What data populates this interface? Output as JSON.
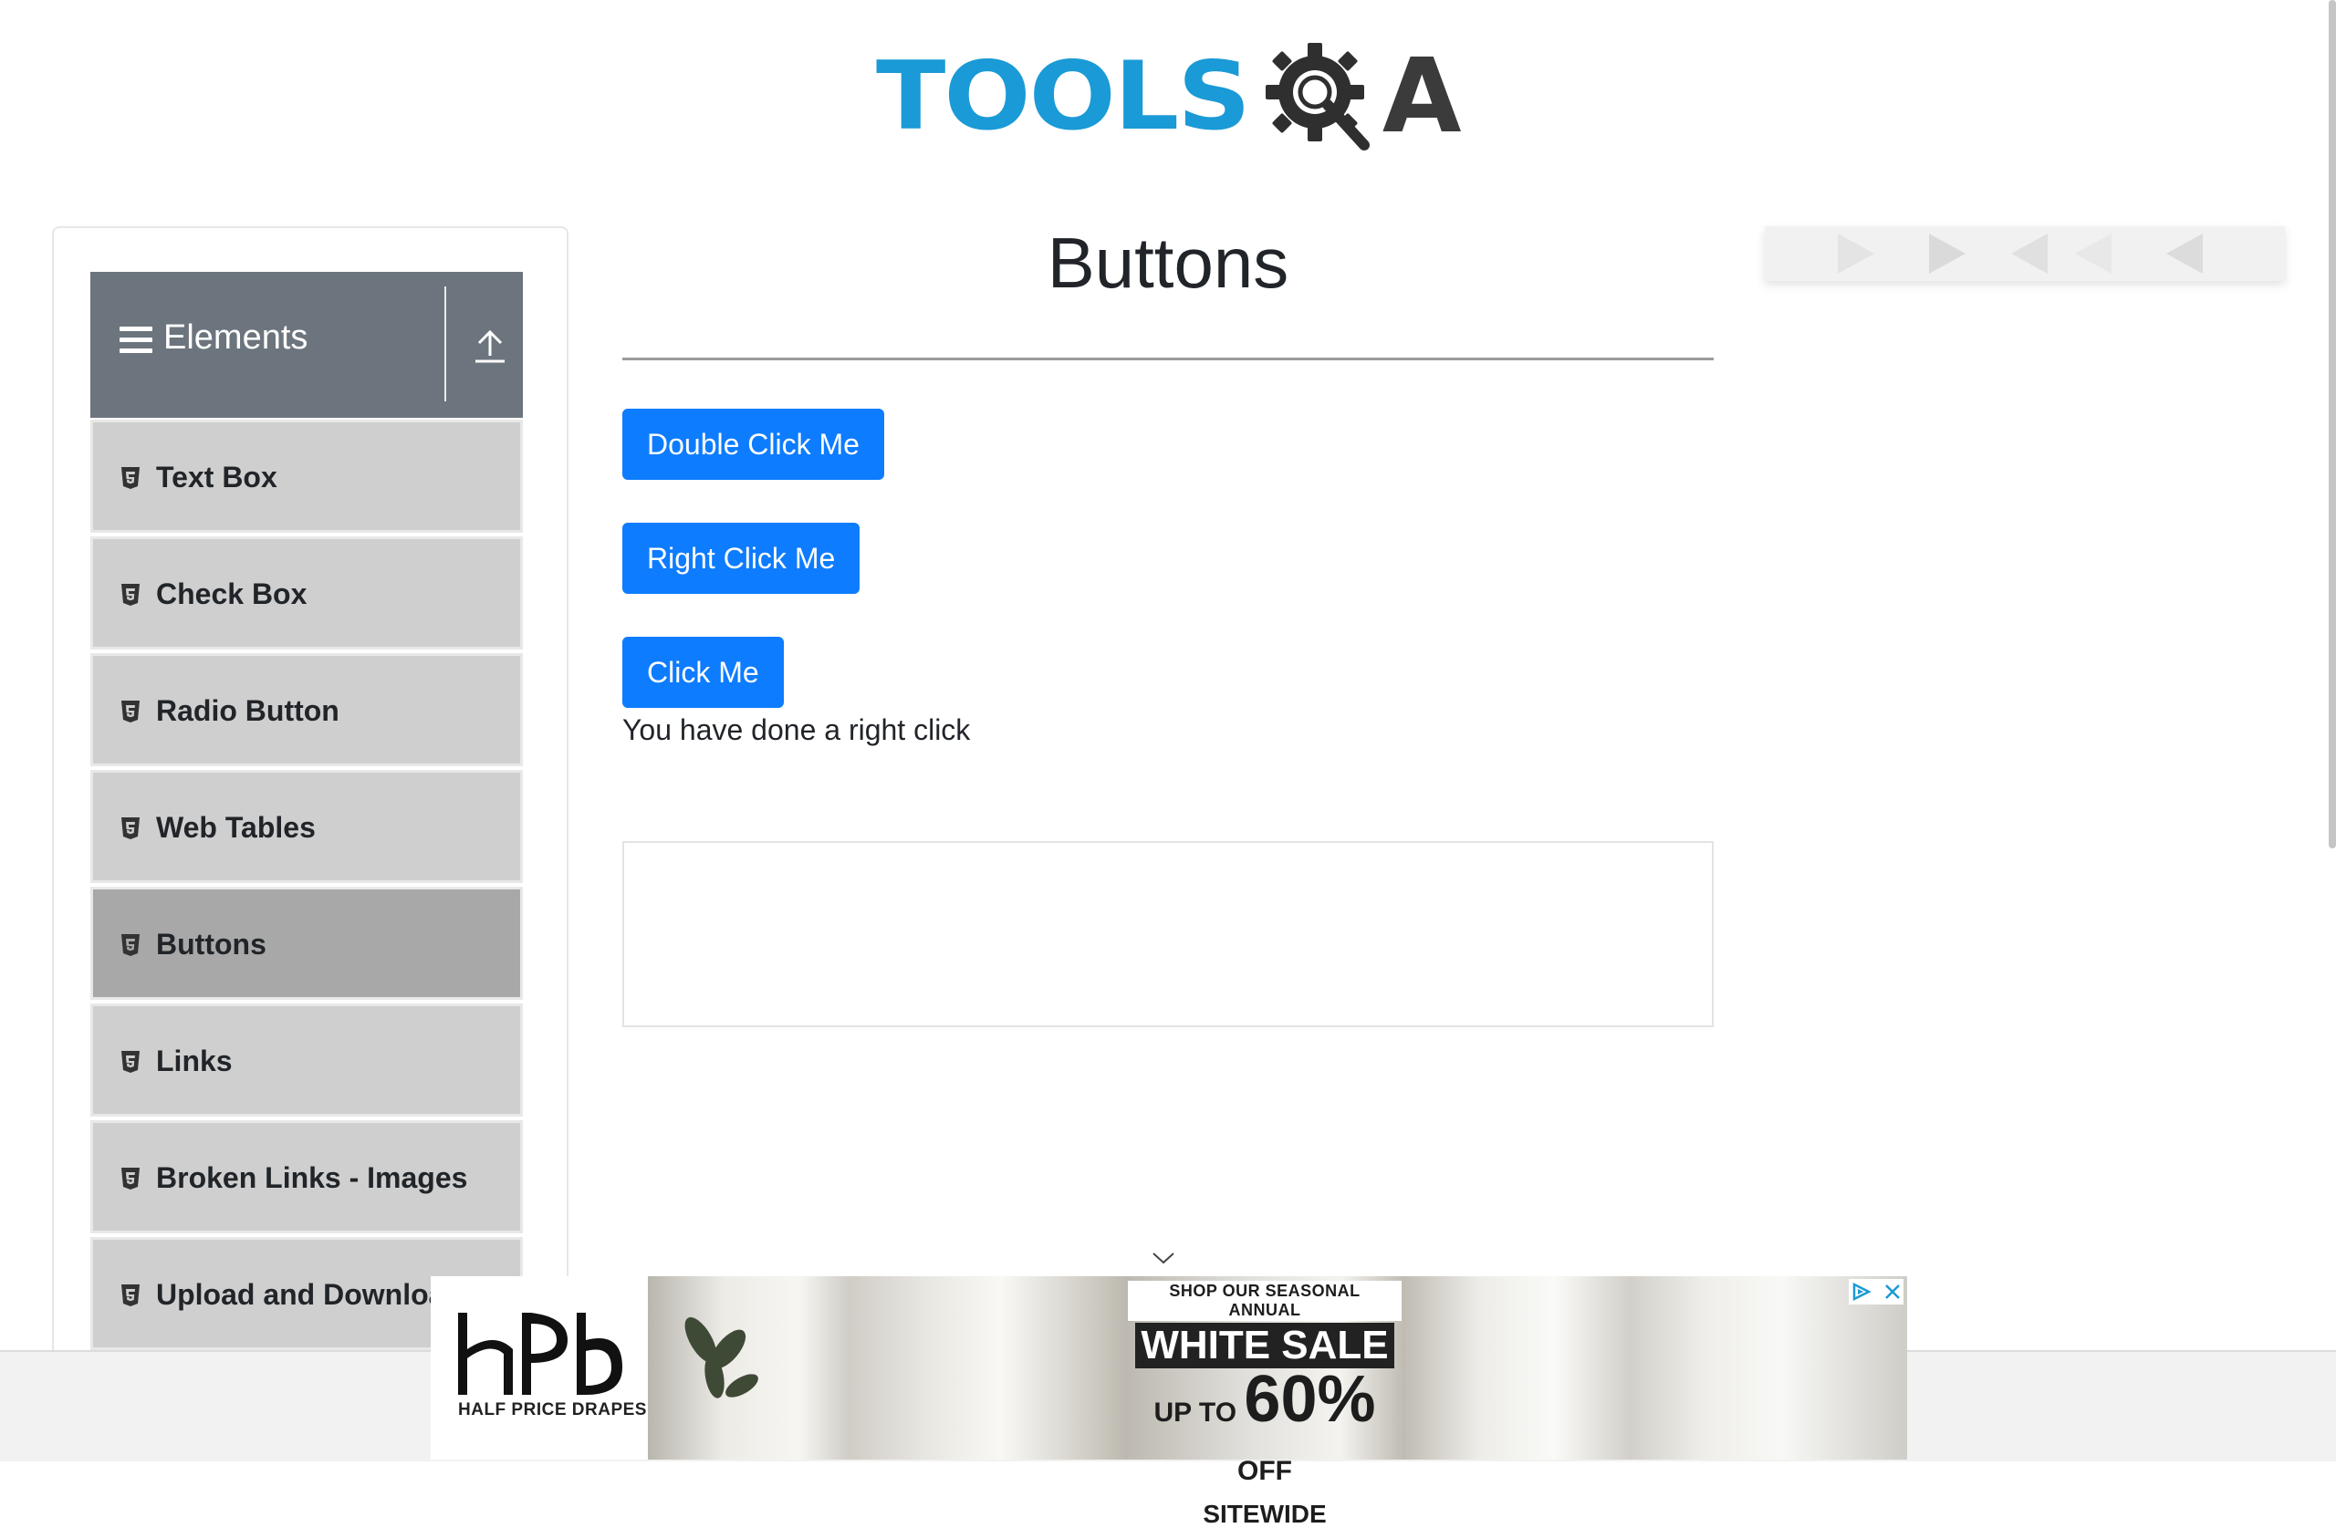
{
  "header": {
    "logo": {
      "tools": "TOOLS",
      "q_icon": "gear-magnifier-icon",
      "a": "A"
    }
  },
  "sidebar": {
    "group_title": "Elements",
    "group_icon": "hamburger-icon",
    "collapse_icon": "arrow-up-icon",
    "items": [
      {
        "label": "Text Box",
        "icon": "html5-icon"
      },
      {
        "label": "Check Box",
        "icon": "html5-icon"
      },
      {
        "label": "Radio Button",
        "icon": "html5-icon"
      },
      {
        "label": "Web Tables",
        "icon": "html5-icon"
      },
      {
        "label": "Buttons",
        "icon": "html5-icon",
        "active": true
      },
      {
        "label": "Links",
        "icon": "html5-icon"
      },
      {
        "label": "Broken Links - Images",
        "icon": "html5-icon"
      },
      {
        "label": "Upload and Download",
        "icon": "html5-icon"
      }
    ]
  },
  "main": {
    "title": "Buttons",
    "buttons": {
      "double_click": "Double Click Me",
      "right_click": "Right Click Me",
      "click": "Click Me"
    },
    "message": "You have done a right click"
  },
  "bottom_ad": {
    "brand": "HALF PRICE DRAPES",
    "kicker": "SHOP OUR SEASONAL ANNUAL",
    "headline": "WHITE SALE",
    "up_to": "UP TO",
    "percent": "60%",
    "off": "OFF",
    "sitewide": "SITEWIDE"
  },
  "colors": {
    "primary_button": "#0d7cff",
    "logo_blue": "#1a9ad6",
    "sidebar_header": "#6c757d",
    "menu_item": "#cfcfcf",
    "menu_item_active": "#a8a8a8"
  }
}
